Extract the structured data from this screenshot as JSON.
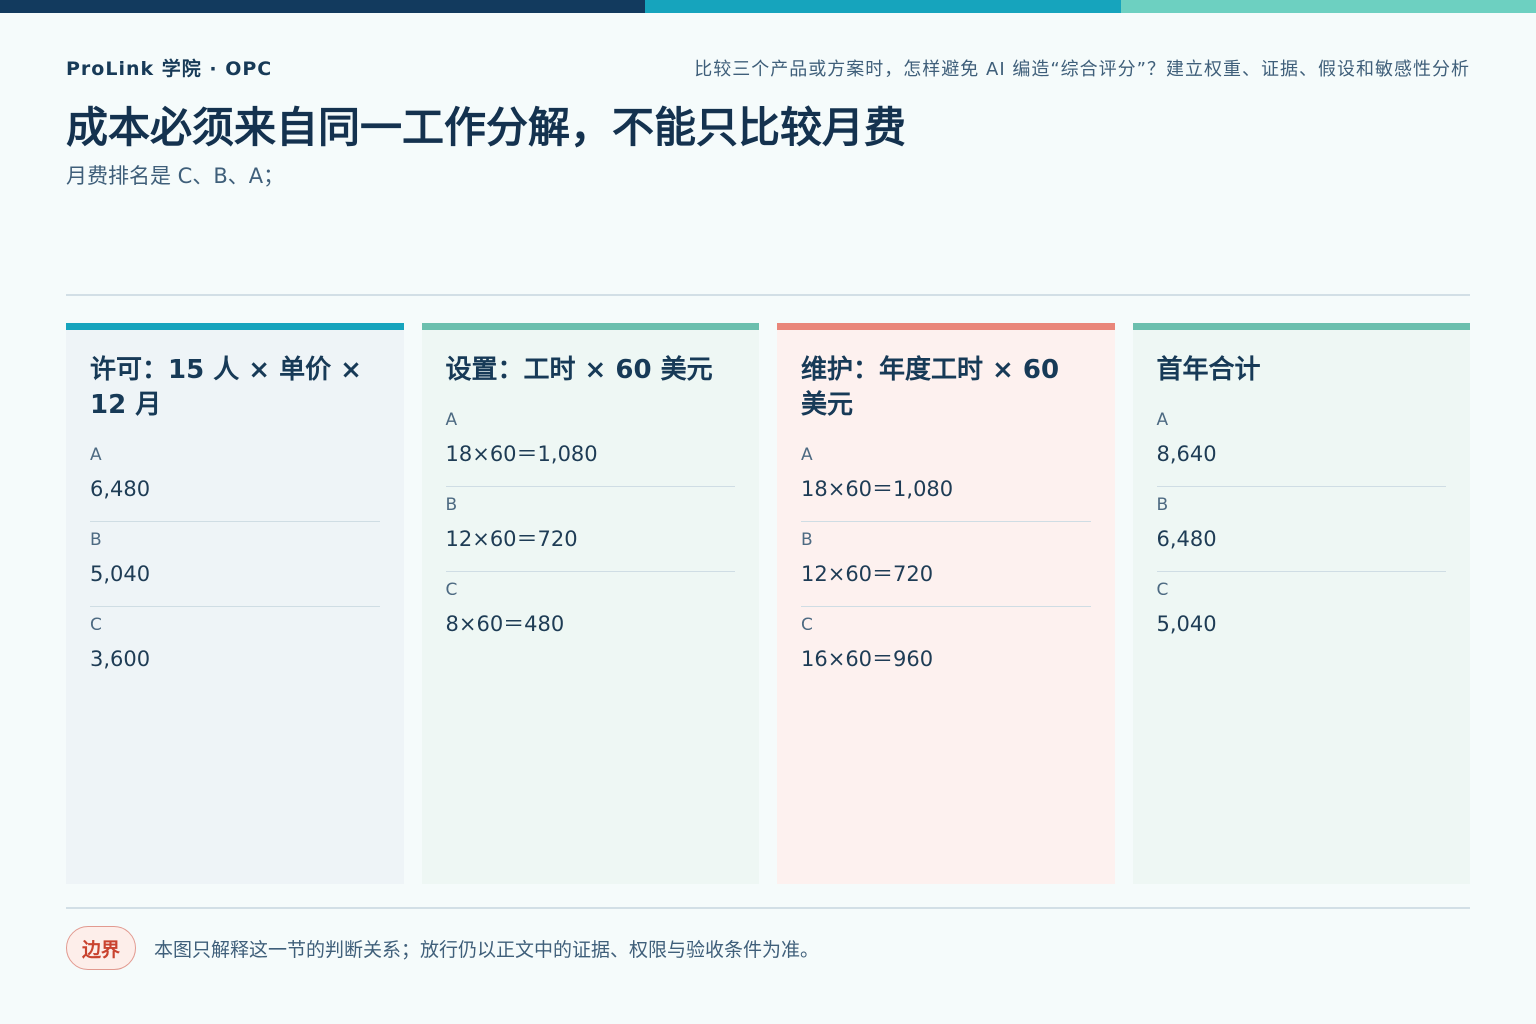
{
  "colors": {
    "bar_dark": "#123a5e",
    "bar_teal": "#16a4bd",
    "bar_mint": "#6dd0c1",
    "card_accent_teal": "#16a4bd",
    "card_accent_green": "#6bbfae",
    "card_accent_coral": "#e9867a",
    "badge_red": "#c9432f"
  },
  "header": {
    "brand": "ProLink 学院 · OPC",
    "question": "比较三个产品或方案时，怎样避免 AI 编造“综合评分”？建立权重、证据、假设和敏感性分析"
  },
  "title": "成本必须来自同一工作分解，不能只比较月费",
  "subtitle": "月费排名是 C、B、A；",
  "cards": [
    {
      "title": "许可：15 人 × 单价 × 12 月",
      "rows": [
        {
          "label": "A",
          "value": "6,480"
        },
        {
          "label": "B",
          "value": "5,040"
        },
        {
          "label": "C",
          "value": "3,600"
        }
      ]
    },
    {
      "title": "设置：工时 × 60 美元",
      "rows": [
        {
          "label": "A",
          "value": "18×60＝1,080"
        },
        {
          "label": "B",
          "value": "12×60＝720"
        },
        {
          "label": "C",
          "value": "8×60＝480"
        }
      ]
    },
    {
      "title": "维护：年度工时 × 60 美元",
      "rows": [
        {
          "label": "A",
          "value": "18×60＝1,080"
        },
        {
          "label": "B",
          "value": "12×60＝720"
        },
        {
          "label": "C",
          "value": "16×60＝960"
        }
      ]
    },
    {
      "title": "首年合计",
      "rows": [
        {
          "label": "A",
          "value": "8,640"
        },
        {
          "label": "B",
          "value": "6,480"
        },
        {
          "label": "C",
          "value": "5,040"
        }
      ]
    }
  ],
  "footer": {
    "badge": "边界",
    "note": "本图只解释这一节的判断关系；放行仍以正文中的证据、权限与验收条件为准。"
  }
}
